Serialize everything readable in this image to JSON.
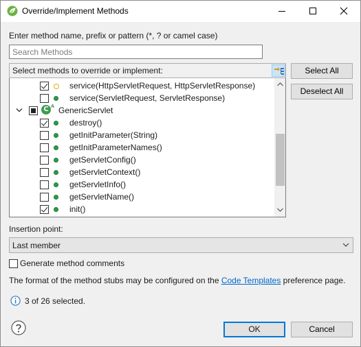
{
  "window": {
    "title": "Override/Implement Methods",
    "icon": "spring-leaf-icon"
  },
  "search": {
    "prompt": "Enter method name, prefix or pattern (*, ? or camel case)",
    "placeholder": "Search Methods",
    "value": ""
  },
  "methods_list": {
    "header": "Select methods to override or implement:",
    "rows": [
      {
        "label": "service(HttpServletRequest, HttpServletResponse)",
        "checked": true,
        "icon": "yellow-circle-icon",
        "kind": "method"
      },
      {
        "label": "service(ServletRequest, ServletResponse)",
        "checked": false,
        "icon": "green-dot-icon",
        "kind": "method"
      },
      {
        "label": "GenericServlet",
        "checked": "partial",
        "icon": "abstract-class-icon",
        "kind": "class",
        "expanded": true
      },
      {
        "label": "destroy()",
        "checked": true,
        "icon": "green-dot-icon",
        "kind": "method"
      },
      {
        "label": "getInitParameter(String)",
        "checked": false,
        "icon": "green-dot-icon",
        "kind": "method"
      },
      {
        "label": "getInitParameterNames()",
        "checked": false,
        "icon": "green-dot-icon",
        "kind": "method"
      },
      {
        "label": "getServletConfig()",
        "checked": false,
        "icon": "green-dot-icon",
        "kind": "method"
      },
      {
        "label": "getServletContext()",
        "checked": false,
        "icon": "green-dot-icon",
        "kind": "method"
      },
      {
        "label": "getServletInfo()",
        "checked": false,
        "icon": "green-dot-icon",
        "kind": "method"
      },
      {
        "label": "getServletName()",
        "checked": false,
        "icon": "green-dot-icon",
        "kind": "method"
      },
      {
        "label": "init()",
        "checked": true,
        "icon": "green-dot-icon",
        "kind": "method"
      }
    ]
  },
  "buttons": {
    "select_all": "Select All",
    "deselect_all": "Deselect All",
    "ok": "OK",
    "cancel": "Cancel"
  },
  "insertion": {
    "label": "Insertion point:",
    "selected": "Last member"
  },
  "options": {
    "generate_comments_label": "Generate method comments",
    "generate_comments_checked": false
  },
  "info": {
    "before": "The format of the method stubs may be configured on the ",
    "link": "Code Templates",
    "after": " preference page."
  },
  "status": {
    "text": "3 of 26 selected."
  },
  "colors": {
    "accent": "#0078d7",
    "link": "#0066cc",
    "method_public": "#2e9a4b",
    "method_protected": "#e3ac1e"
  }
}
